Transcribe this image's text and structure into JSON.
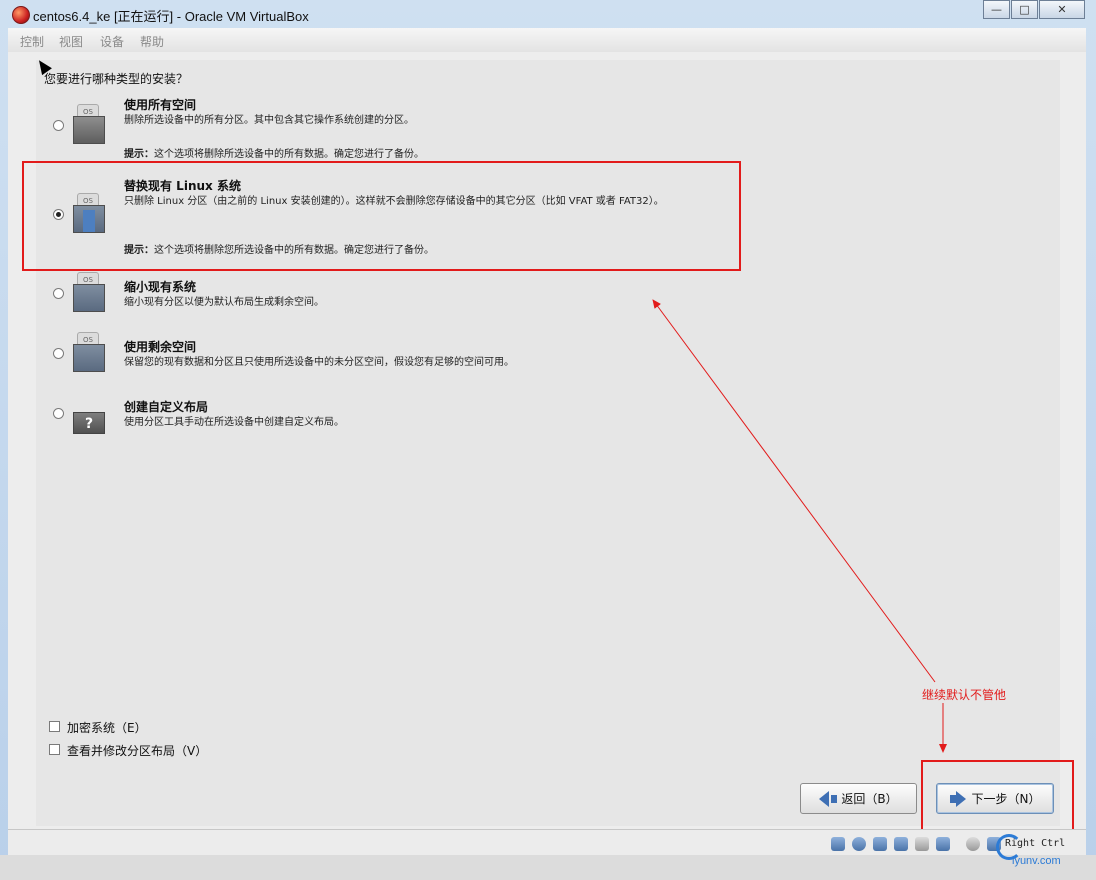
{
  "window": {
    "title": "centos6.4_ke [正在运行] - Oracle VM VirtualBox",
    "controls": {
      "minimize": "—",
      "maximize": "□",
      "close": "✕"
    }
  },
  "menu": {
    "items": [
      "控制",
      "视图",
      "设备",
      "帮助"
    ]
  },
  "installer": {
    "question": "您要进行哪种类型的安装？",
    "options": [
      {
        "title": "使用所有空间",
        "desc": "删除所选设备中的所有分区。其中包含其它操作系统创建的分区。",
        "hint_label": "提示：",
        "hint": "这个选项将删除所选设备中的所有数据。确定您进行了备份。",
        "selected": false,
        "icon": "disk-os-icon"
      },
      {
        "title": "替换现有 Linux 系统",
        "desc": "只删除 Linux 分区（由之前的 Linux 安装创建的）。这样就不会删除您存储设备中的其它分区（比如 VFAT 或者 FAT32）。",
        "hint_label": "提示：",
        "hint": "这个选项将删除您所选设备中的所有数据。确定您进行了备份。",
        "selected": true,
        "icon": "disk-os-linux-icon"
      },
      {
        "title": "缩小现有系统",
        "desc": "缩小现有分区以便为默认布局生成剩余空间。",
        "selected": false,
        "icon": "disk-shrink-icon"
      },
      {
        "title": "使用剩余空间",
        "desc": "保留您的现有数据和分区且只使用所选设备中的未分区空间，假设您有足够的空间可用。",
        "selected": false,
        "icon": "disk-free-space-icon"
      },
      {
        "title": "创建自定义布局",
        "desc": "使用分区工具手动在所选设备中创建自定义布局。",
        "selected": false,
        "icon": "question-disk-icon"
      }
    ],
    "checkboxes": [
      {
        "label": "加密系统（E）",
        "checked": false
      },
      {
        "label": "查看并修改分区布局（V）",
        "checked": false
      }
    ],
    "buttons": {
      "back": "返回（B）",
      "next": "下一步（N）"
    }
  },
  "annotation": {
    "note": "继续默认不管他",
    "color": "#e21b1b"
  },
  "statusbar": {
    "host_key": "Right Ctrl"
  },
  "watermark": {
    "text": "iyunv.com"
  }
}
